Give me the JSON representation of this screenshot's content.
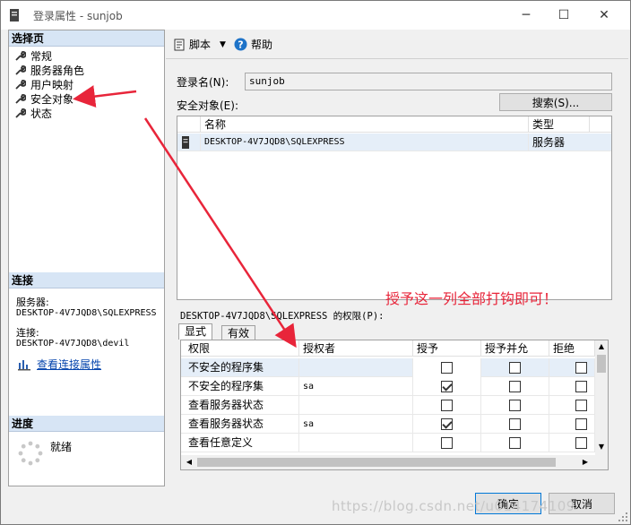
{
  "window": {
    "title": "登录属性 - sunjob",
    "min": "─",
    "max": "☐",
    "close": "✕"
  },
  "left_pane": {
    "select_page_header": "选择页",
    "pages": [
      {
        "label": "常规"
      },
      {
        "label": "服务器角色"
      },
      {
        "label": "用户映射"
      },
      {
        "label": "安全对象"
      },
      {
        "label": "状态"
      }
    ],
    "connection_header": "连接",
    "server_label": "服务器:",
    "server_value": "DESKTOP-4V7JQD8\\SQLEXPRESS",
    "connection_label": "连接:",
    "connection_value": "DESKTOP-4V7JQD8\\devil",
    "view_conn_link": "查看连接属性",
    "progress_header": "进度",
    "progress_status": "就绪"
  },
  "toolbar": {
    "script_label": "脚本",
    "help_label": "帮助"
  },
  "main": {
    "login_name_label": "登录名(N):",
    "login_name_value": "sunjob",
    "securables_label": "安全对象(E):",
    "search_button": "搜索(S)...",
    "securables_columns": [
      "名称",
      "类型"
    ],
    "securables_rows": [
      {
        "name": "DESKTOP-4V7JQD8\\SQLEXPRESS",
        "type": "服务器"
      }
    ],
    "permissions_label": "DESKTOP-4V7JQD8\\SQLEXPRESS 的权限(P):",
    "tabs": [
      "显式",
      "有效"
    ],
    "perm_columns": [
      "权限",
      "授权者",
      "授予",
      "授予并允",
      "拒绝"
    ],
    "perm_rows": [
      {
        "permission": "不安全的程序集",
        "grantor": "",
        "grant": false,
        "with_grant": false,
        "deny": false
      },
      {
        "permission": "不安全的程序集",
        "grantor": "sa",
        "grant": true,
        "with_grant": false,
        "deny": false
      },
      {
        "permission": "查看服务器状态",
        "grantor": "",
        "grant": false,
        "with_grant": false,
        "deny": false
      },
      {
        "permission": "查看服务器状态",
        "grantor": "sa",
        "grant": true,
        "with_grant": false,
        "deny": false
      },
      {
        "permission": "查看任意定义",
        "grantor": "",
        "grant": false,
        "with_grant": false,
        "deny": false
      }
    ]
  },
  "footer": {
    "ok_button": "确定",
    "cancel_button": "取消"
  },
  "annotation": {
    "text": "授予这一列全部打钩即可！",
    "color": "#e8253a"
  },
  "watermark": "https://blog.csdn.net/u014174109"
}
